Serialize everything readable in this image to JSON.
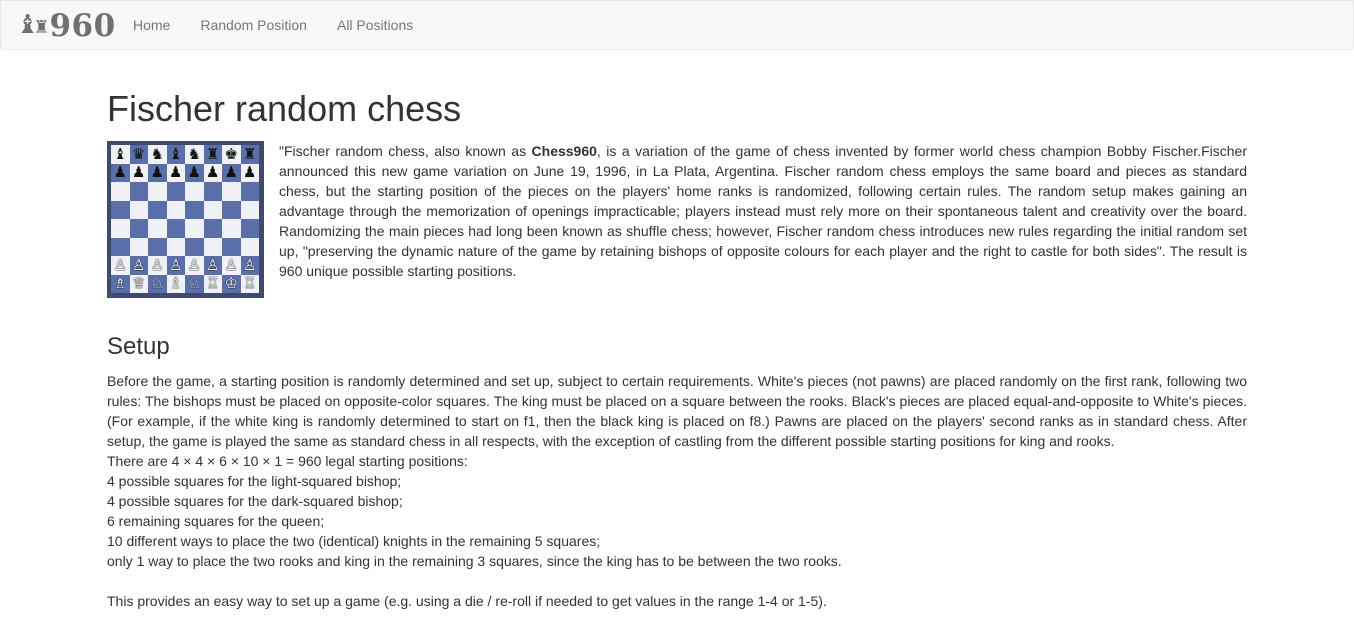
{
  "navbar": {
    "brand_text": "960",
    "brand_pieces": [
      "♝",
      "♜"
    ],
    "links": [
      {
        "label": "Home"
      },
      {
        "label": "Random Position"
      },
      {
        "label": "All Positions"
      }
    ]
  },
  "main": {
    "title": "Fischer random chess",
    "intro": {
      "before_bold": "\"Fischer random chess, also known as ",
      "bold": "Chess960",
      "after_bold": ", is a variation of the game of chess invented by former world chess champion Bobby Fischer.Fischer announced this new game variation on June 19, 1996, in La Plata, Argentina. Fischer random chess employs the same board and pieces as standard chess, but the starting position of the pieces on the players' home ranks is randomized, following certain rules. The random setup makes gaining an advantage through the memorization of openings impracticable; players instead must rely more on their spontaneous talent and creativity over the board. Randomizing the main pieces had long been known as shuffle chess; however, Fischer random chess introduces new rules regarding the initial random set up, \"preserving the dynamic nature of the game by retaining bishops of opposite colours for each player and the right to castle for both sides\". The result is 960 unique possible starting positions."
    },
    "board": {
      "black_back_rank": [
        "♝",
        "♛",
        "♞",
        "♝",
        "♞",
        "♜",
        "♚",
        "♜"
      ],
      "black_pawns": [
        "♟",
        "♟",
        "♟",
        "♟",
        "♟",
        "♟",
        "♟",
        "♟"
      ],
      "white_pawns": [
        "♙",
        "♙",
        "♙",
        "♙",
        "♙",
        "♙",
        "♙",
        "♙"
      ],
      "white_back_rank": [
        "♗",
        "♕",
        "♘",
        "♗",
        "♘",
        "♖",
        "♔",
        "♖"
      ]
    },
    "setup": {
      "heading": "Setup",
      "paragraph": "Before the game, a starting position is randomly determined and set up, subject to certain requirements. White's pieces (not pawns) are placed randomly on the first rank, following two rules: The bishops must be placed on opposite-color squares. The king must be placed on a square between the rooks. Black's pieces are placed equal-and-opposite to White's pieces. (For example, if the white king is randomly determined to start on f1, then the black king is placed on f8.) Pawns are placed on the players' second ranks as in standard chess. After setup, the game is played the same as standard chess in all respects, with the exception of castling from the different possible starting positions for king and rooks.",
      "lines": [
        "There are 4 × 4 × 6 × 10 × 1 = 960 legal starting positions:",
        "4 possible squares for the light-squared bishop;",
        "4 possible squares for the dark-squared bishop;",
        "6 remaining squares for the queen;",
        "10 different ways to place the two (identical) knights in the remaining 5 squares;",
        "only 1 way to place the two rooks and king in the remaining 3 squares, since the king has to be between the two rooks."
      ],
      "closing": "This provides an easy way to set up a game (e.g. using a die / re-roll if needed to get values in the range 1-4 or 1-5)."
    }
  },
  "colors": {
    "navbar_bg": "#f8f8f8",
    "nav_link": "#777777",
    "text": "#333333",
    "board_dark": "#5a6faa",
    "board_light": "#f0f1f4",
    "board_frame": "#404a6e"
  }
}
